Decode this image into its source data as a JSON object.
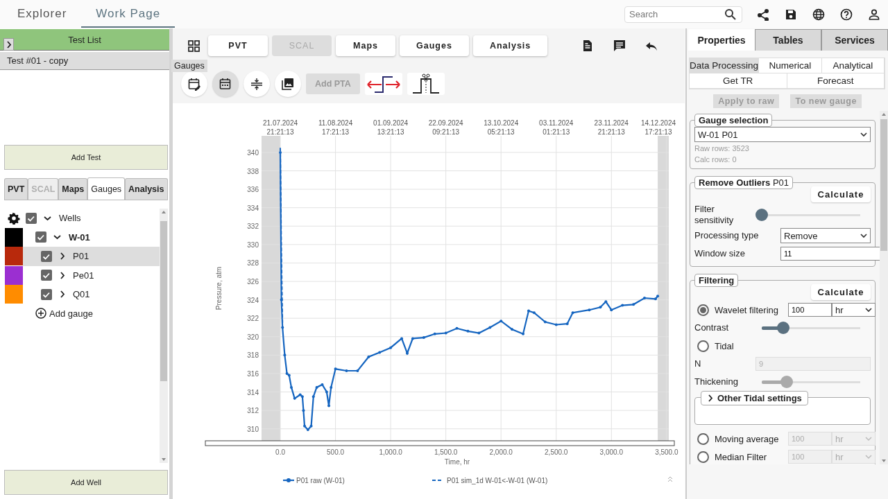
{
  "top_bar": {
    "tabs": [
      {
        "label": "Explorer",
        "selected": false
      },
      {
        "label": "Work Page",
        "selected": true
      }
    ],
    "search": {
      "placeholder": "Search"
    }
  },
  "left_panel": {
    "test_list": {
      "title": "Test List",
      "items": [
        {
          "label": "Test #01 - copy",
          "selected": true
        }
      ],
      "add_button": "Add Test"
    },
    "tabs": [
      {
        "label": "PVT",
        "selected": false,
        "disabled": false
      },
      {
        "label": "SCAL",
        "selected": false,
        "disabled": true
      },
      {
        "label": "Maps",
        "selected": false,
        "disabled": false
      },
      {
        "label": "Gauges",
        "selected": true,
        "disabled": false
      },
      {
        "label": "Analysis",
        "selected": false,
        "disabled": false
      }
    ],
    "tree": [
      {
        "kind": "folder",
        "label": "Wells",
        "checked": true,
        "expanded": true,
        "selected": false,
        "children": [
          {
            "kind": "well",
            "label": "W-01",
            "color": "#000000",
            "checked": true,
            "expanded": true,
            "selected": false,
            "children": [
              {
                "kind": "gauge",
                "label": "P01",
                "color": "#b8290c",
                "checked": true,
                "expanded": false,
                "selected": true
              },
              {
                "kind": "gauge",
                "label": "Pe01",
                "color": "#9b2fd1",
                "checked": true,
                "expanded": false,
                "selected": false
              },
              {
                "kind": "gauge",
                "label": "Q01",
                "color": "#ff8c00",
                "checked": true,
                "expanded": false,
                "selected": false
              }
            ]
          }
        ]
      }
    ],
    "add_gauge": "Add gauge",
    "add_well": "Add Well"
  },
  "workspace": {
    "tabs": [
      {
        "label": "PVT",
        "disabled": false
      },
      {
        "label": "SCAL",
        "disabled": true
      },
      {
        "label": "Maps",
        "disabled": false
      },
      {
        "label": "Gauges",
        "disabled": false
      },
      {
        "label": "Analysis",
        "disabled": false
      }
    ],
    "tooltip": "Gauges",
    "view_toggles": [
      {
        "selected": false
      },
      {
        "selected": true
      },
      {
        "selected": false
      },
      {
        "selected": false
      }
    ],
    "add_pta": {
      "label": "Add PTA",
      "disabled": true
    },
    "chart": {
      "top_axis": [
        {
          "date": "21.07.2024",
          "time": "21:21:13"
        },
        {
          "date": "11.08.2024",
          "time": "17:21:13"
        },
        {
          "date": "01.09.2024",
          "time": "13:21:13"
        },
        {
          "date": "22.09.2024",
          "time": "09:21:13"
        },
        {
          "date": "13.10.2024",
          "time": "05:21:13"
        },
        {
          "date": "03.11.2024",
          "time": "01:21:13"
        },
        {
          "date": "23.11.2024",
          "time": "21:21:13"
        },
        {
          "date": "14.12.2024",
          "time": "17:21:13"
        }
      ],
      "chart_data": {
        "type": "line",
        "xlabel": "Time, hr",
        "ylabel": "Pressure, atm",
        "x": [
          0,
          10,
          20,
          40,
          60,
          80,
          100,
          130,
          180,
          200,
          210,
          220,
          250,
          280,
          300,
          330,
          380,
          420,
          440,
          460,
          500,
          600,
          700,
          800,
          900,
          1000,
          1100,
          1150,
          1200,
          1300,
          1400,
          1500,
          1600,
          1700,
          1800,
          1900,
          2000,
          2100,
          2200,
          2250,
          2300,
          2400,
          2500,
          2600,
          2650,
          2800,
          2900,
          2950,
          3000,
          3100,
          3200,
          3300,
          3400,
          3420
        ],
        "series": [
          {
            "name": "P01 raw (W-01)",
            "color": "#1565c0",
            "values": [
              340,
              324,
              321,
              318,
              316,
              315.8,
              314.5,
              313.3,
              313.7,
              313.5,
              312,
              310.3,
              309.9,
              310.3,
              313.5,
              314.5,
              314.8,
              314,
              312.5,
              314.5,
              316.5,
              316.3,
              316.3,
              317.8,
              318.3,
              318.8,
              319.8,
              318.2,
              319.8,
              319.9,
              320.3,
              320.4,
              320.9,
              320.6,
              320.4,
              321,
              321.7,
              320.8,
              320.3,
              322.8,
              322.6,
              321.6,
              321.3,
              321.4,
              322.6,
              322.9,
              323.2,
              323.8,
              322.9,
              323.4,
              323.5,
              324.2,
              324.1,
              324.4
            ]
          },
          {
            "name": "P01 sim_1d W-01<-W-01 (W-01)",
            "line_style": "dashed",
            "color": "#1565c0",
            "values": [
              340.5,
              329,
              321.5,
              null,
              null,
              null,
              null,
              null,
              null,
              null,
              null,
              null,
              null,
              null,
              null,
              null,
              null,
              null,
              null,
              null,
              null,
              null,
              null,
              null,
              null,
              null,
              null,
              null,
              null,
              null,
              null,
              null,
              null,
              null,
              null,
              null,
              null,
              null,
              null,
              null,
              null,
              null,
              null,
              null,
              null,
              null,
              null,
              null,
              null,
              null,
              null,
              null,
              null,
              null
            ]
          }
        ],
        "xlim": [
          -170,
          3520
        ],
        "ylim": [
          308.7,
          341.8
        ],
        "xticks": [
          {
            "value": 0,
            "label": "0.0"
          },
          {
            "value": 500,
            "label": "500.0"
          },
          {
            "value": 1000,
            "label": "1,000.0"
          },
          {
            "value": 1500,
            "label": "1,500.0"
          },
          {
            "value": 2000,
            "label": "2,000.0"
          },
          {
            "value": 2500,
            "label": "2,500.0"
          },
          {
            "value": 3000,
            "label": "3,000.0"
          },
          {
            "value": 3500,
            "label": "3,500.0"
          }
        ],
        "yticks": [
          310,
          312,
          314,
          316,
          318,
          320,
          322,
          324,
          326,
          328,
          330,
          332,
          334,
          336,
          338,
          340
        ],
        "grid": true,
        "legend": "bottom",
        "bands": [
          {
            "axis": "x",
            "from": -170,
            "to": 0
          },
          {
            "axis": "x",
            "from": 3420,
            "to": 3520
          }
        ]
      }
    }
  },
  "properties_panel": {
    "tabs": [
      {
        "label": "Properties",
        "selected": true
      },
      {
        "label": "Tables",
        "selected": false
      },
      {
        "label": "Services",
        "selected": false
      }
    ],
    "subtab_rows": [
      {
        "tabs": [
          {
            "label": "Data Processing",
            "selected": true
          },
          {
            "label": "Numerical",
            "selected": false
          },
          {
            "label": "Analytical",
            "selected": false
          }
        ]
      },
      {
        "tabs": [
          {
            "label": "Get TR",
            "selected": false
          },
          {
            "label": "Forecast",
            "selected": false
          }
        ]
      }
    ],
    "actions": [
      {
        "label": "Apply to raw",
        "disabled": true
      },
      {
        "label": "To new gauge",
        "disabled": true
      }
    ],
    "gauge_selection": {
      "title": "Gauge selection",
      "value": "W-01 P01",
      "info": [
        "Raw rows: 3523",
        "Calc rows: 0"
      ]
    },
    "remove_outliers": {
      "title": "**Remove Outliers** P01",
      "calculate": "Calculate",
      "items": [
        {
          "kind": "slider",
          "label": "Filter sensitivity",
          "level": 0,
          "disabled": false
        },
        {
          "kind": "select",
          "label": "Processing type",
          "value": "Remove"
        },
        {
          "kind": "input",
          "label": "Window size",
          "value": "11",
          "disabled": false
        }
      ]
    },
    "filtering": {
      "title": "Filtering",
      "calculate": "Calculate",
      "items": [
        {
          "kind": "radio",
          "label": "Wavelet filtering",
          "selected": true,
          "value": "100",
          "unit": "hr",
          "disabled": false
        },
        {
          "kind": "slider",
          "label": "Contrast",
          "level": 0.22,
          "disabled": false
        },
        {
          "kind": "radio",
          "label": "Tidal",
          "selected": false
        },
        {
          "kind": "input",
          "label": "N",
          "value": "9",
          "disabled": true
        },
        {
          "kind": "slider",
          "label": "Thickening",
          "level": 0.25,
          "disabled": true
        },
        {
          "kind": "group",
          "label": "Other Tidal settings",
          "expanded": false
        },
        {
          "kind": "radio",
          "label": "Moving average",
          "selected": false,
          "value": "100",
          "unit": "hr",
          "disabled": true
        },
        {
          "kind": "radio",
          "label": "Median Filter",
          "selected": false,
          "value": "100",
          "unit": "hr",
          "disabled": true
        }
      ]
    }
  }
}
